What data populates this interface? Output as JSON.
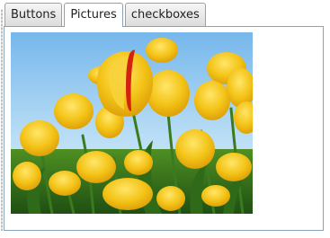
{
  "tabs": [
    {
      "label": "Buttons",
      "active": false
    },
    {
      "label": "Pictures",
      "active": true
    },
    {
      "label": "checkboxes",
      "active": false
    }
  ],
  "picture": {
    "subject": "yellow tulips against blue sky"
  },
  "colors": {
    "tab_border": "#9aa0a6",
    "panel_border": "#8aa2b8",
    "sky": "#8fc7ee",
    "tulip_yellow": "#f2c318",
    "stem_green": "#3b7a1e"
  }
}
